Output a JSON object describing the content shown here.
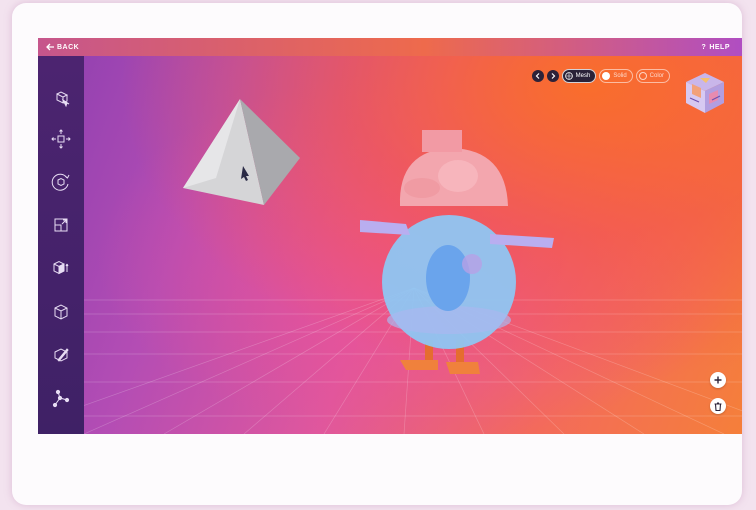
{
  "header": {
    "back_label": "BACK",
    "help_label": "HELP",
    "help_prefix": "?"
  },
  "sidebar": {
    "tools": [
      {
        "icon": "select-icon"
      },
      {
        "icon": "move-icon"
      },
      {
        "icon": "rotate-icon"
      },
      {
        "icon": "scale-icon"
      },
      {
        "icon": "add-shape-icon"
      },
      {
        "icon": "cube-icon"
      },
      {
        "icon": "paint-icon"
      },
      {
        "icon": "points-icon"
      }
    ]
  },
  "view_controls": {
    "mesh_label": "Mesh",
    "solid_label": "Solid",
    "color_label": "Color",
    "selected": "Mesh"
  },
  "colors": {
    "sidebar": "#45226b",
    "accent_orange": "#f36a3c",
    "accent_pink": "#e0579d",
    "body_blue": "#86bff0",
    "head_pink": "#f3a0ad",
    "legs_orange": "#f0813c"
  }
}
